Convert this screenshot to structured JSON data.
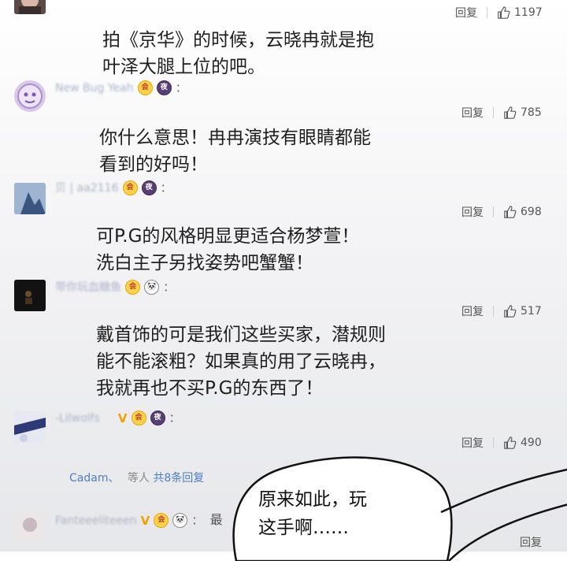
{
  "colors": {
    "username": "#aab4c8",
    "link": "#4e7ec2",
    "badge_vip": "#ffd24a",
    "badge_night": "#5a3f75"
  },
  "badges": {
    "vip": "会",
    "night": "夜",
    "panda": "🐼",
    "v": "V"
  },
  "comments": [
    {
      "username": "",
      "lines": [
        "拍《京华》的时候，云晓冉就是抱",
        "叶泽大腿上位的吧。"
      ],
      "reply_label": "回复",
      "likes": "1197"
    },
    {
      "username": "New Bug        Yeah",
      "lines": [
        "你什么意思！冉冉演技有眼睛都能",
        "看到的好吗！"
      ],
      "reply_label": "回复",
      "likes": "785"
    },
    {
      "username": "贝 | aa2116",
      "lines": [
        "可P.G的风格明显更适合杨梦萱！",
        "洗白主子另找姿势吧蟹蟹！"
      ],
      "reply_label": "回复",
      "likes": "698"
    },
    {
      "username": "带你玩血糖鱼",
      "lines": [
        "戴首饰的可是我们这些买家，潜规则",
        "能不能滚粗？如果真的用了云晓冉，",
        "我就再也不买P.G的东西了！"
      ],
      "reply_label": "回复",
      "likes": "517"
    },
    {
      "username": "-Lilwolfs",
      "reply_label": "回复",
      "likes": "490",
      "replies_summary": {
        "names": "Cadam、",
        "middle": "等人",
        "count": "共8条回复"
      }
    },
    {
      "username": "Fanteeeliteeen",
      "preview": "最",
      "reply_label": "回复"
    }
  ],
  "bubble": {
    "lines": [
      "原来如此，玩",
      "这手啊……"
    ]
  }
}
